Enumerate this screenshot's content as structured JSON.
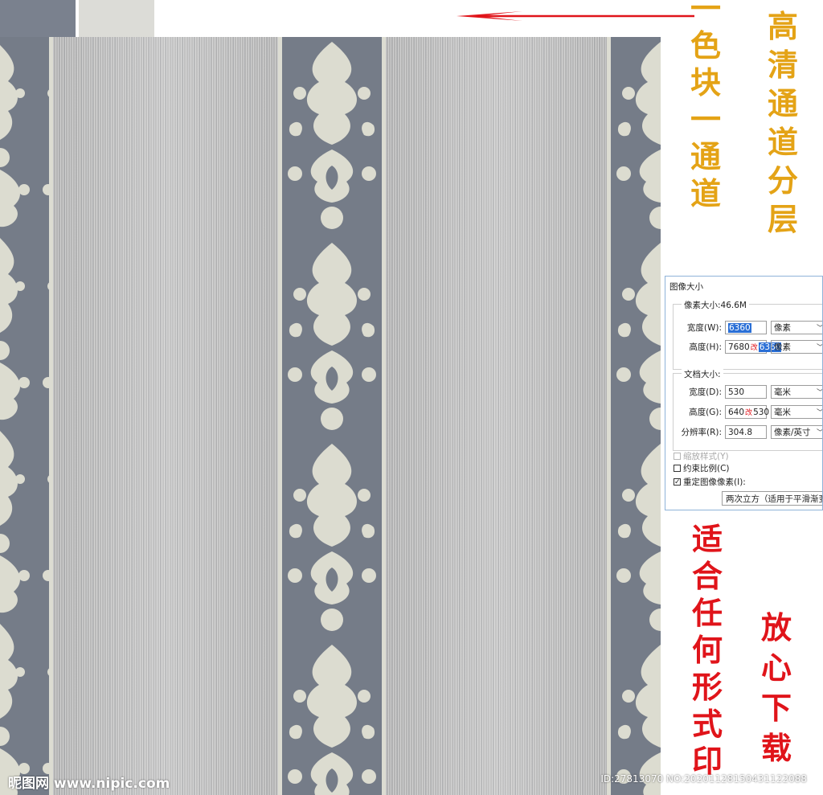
{
  "swatches": [
    {
      "color": "#7a818e"
    },
    {
      "color": "#dcdcd7"
    }
  ],
  "annotations": {
    "gold_text": [
      "高",
      "清",
      "通",
      "道",
      "分",
      "层"
    ],
    "gold_text2": [
      "一",
      "色",
      "块",
      "一",
      "通",
      "道"
    ],
    "red_text": [
      "适",
      "合",
      "任",
      "何",
      "形",
      "式",
      "印"
    ],
    "red_text2": [
      "放",
      "心",
      "下",
      "载"
    ]
  },
  "dialog": {
    "title": "图像大小",
    "pixel_size_label": "像素大小:46.6M",
    "width_label": "宽度(W):",
    "width_value": "6360",
    "width_unit": "像素",
    "height_label": "高度(H):",
    "height_value_old": "7680",
    "height_value_mark": "改",
    "height_value_new": "6360",
    "height_unit": "像素",
    "doc_size_label": "文档大小:",
    "doc_width_label": "宽度(D):",
    "doc_width_value": "530",
    "doc_width_unit": "毫米",
    "doc_height_label": "高度(G):",
    "doc_height_value_old": "640",
    "doc_height_value_mark": "改",
    "doc_height_value_new": "530",
    "doc_height_unit": "毫米",
    "resolution_label": "分辨率(R):",
    "resolution_value": "304.8",
    "resolution_unit": "像素/英寸",
    "scale_styles_label": "缩放样式(Y)",
    "constrain_label": "约束比例(C)",
    "resample_label": "重定图像像素(I):",
    "resample_value": "两次立方（适用于平滑渐变"
  },
  "watermark": "昵图网 www.nipic.com",
  "id_text": "ID:27813070 NO:20201128150431122088"
}
